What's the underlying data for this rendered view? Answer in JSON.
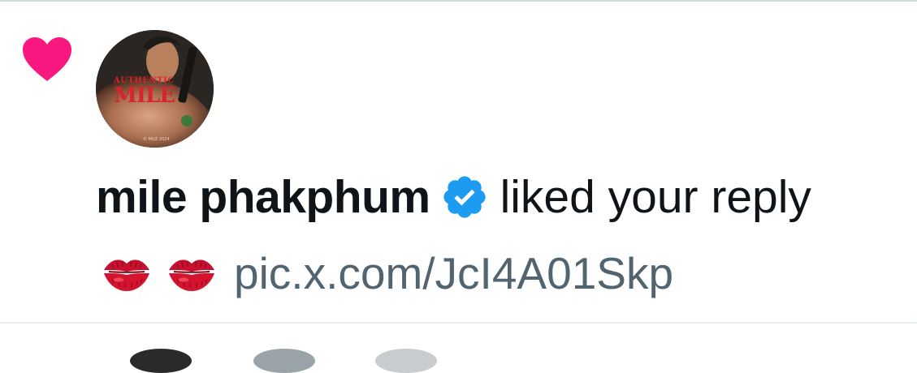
{
  "notification": {
    "type_icon": "heart-icon",
    "user": {
      "display_name": "mile phakphum",
      "verified": true,
      "avatar_text_small": "AUTHENTIC",
      "avatar_text_big": "MILE"
    },
    "action_text": "liked your reply",
    "reply": {
      "emoji_1": "kiss-mark-icon",
      "emoji_2": "kiss-mark-icon",
      "link_text": "pic.x.com/JcI4A01Skp"
    }
  },
  "colors": {
    "heart": "#f91880",
    "verified": "#1d9bf0",
    "text_primary": "#0f1419",
    "text_secondary": "#536471",
    "divider": "#cfd9de"
  }
}
